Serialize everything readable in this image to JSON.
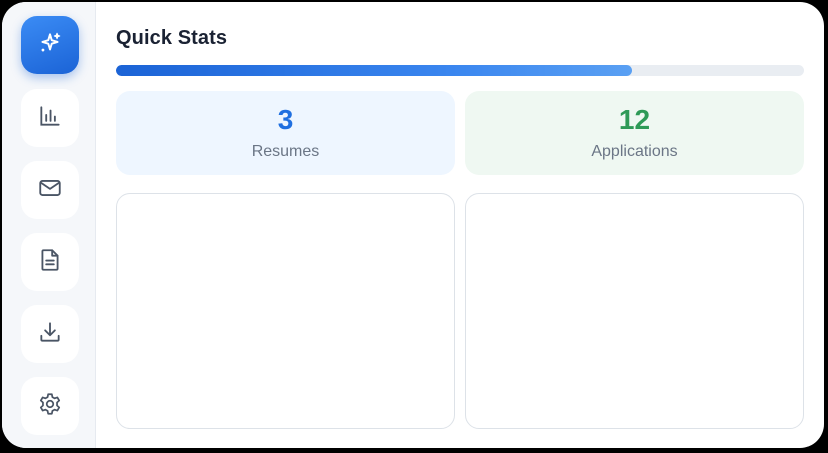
{
  "sidebar": {
    "items": [
      {
        "icon": "sparkles-icon",
        "active": true
      },
      {
        "icon": "bar-chart-icon",
        "active": false
      },
      {
        "icon": "mail-icon",
        "active": false
      },
      {
        "icon": "document-icon",
        "active": false
      },
      {
        "icon": "download-icon",
        "active": false
      },
      {
        "icon": "gear-icon",
        "active": false
      }
    ]
  },
  "main": {
    "title": "Quick Stats",
    "progress": {
      "fraction": 0.75
    },
    "stats": [
      {
        "value": "3",
        "label": "Resumes",
        "color": "#1f6fe0"
      },
      {
        "value": "12",
        "label": "Applications",
        "color": "#2e9a57"
      }
    ]
  },
  "colors": {
    "accent": "#1b63d6",
    "sidebar_bg": "#f5f7fa",
    "icon": "#4a5565"
  }
}
